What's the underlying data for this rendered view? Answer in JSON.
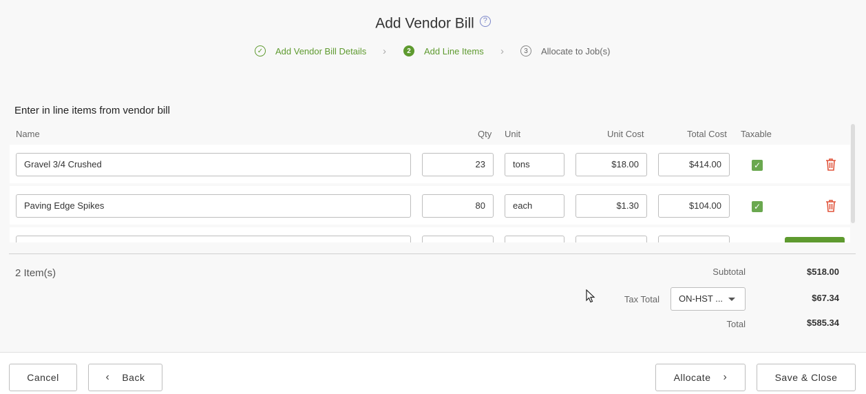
{
  "header": {
    "title": "Add Vendor Bill"
  },
  "steps": [
    {
      "num": "✓",
      "label": "Add Vendor Bill Details",
      "state": "done"
    },
    {
      "num": "2",
      "label": "Add Line Items",
      "state": "active"
    },
    {
      "num": "3",
      "label": "Allocate to Job(s)",
      "state": "todo"
    }
  ],
  "section_title": "Enter in line items from vendor bill",
  "columns": {
    "name": "Name",
    "qty": "Qty",
    "unit": "Unit",
    "unit_cost": "Unit Cost",
    "total_cost": "Total Cost",
    "taxable": "Taxable"
  },
  "line_items": [
    {
      "name": "Gravel 3/4 Crushed",
      "qty": "23",
      "unit": "tons",
      "unit_cost": "$18.00",
      "total_cost": "$414.00",
      "taxable": true
    },
    {
      "name": "Paving Edge Spikes",
      "qty": "80",
      "unit": "each",
      "unit_cost": "$1.30",
      "total_cost": "$104.00",
      "taxable": true
    }
  ],
  "summary": {
    "count": "2 Item(s)",
    "subtotal_label": "Subtotal",
    "subtotal": "$518.00",
    "tax_label": "Tax Total",
    "tax_select": "ON-HST ...",
    "tax": "$67.34",
    "total_label": "Total",
    "total": "$585.34"
  },
  "footer": {
    "cancel": "Cancel",
    "back": "Back",
    "allocate": "Allocate",
    "save_close": "Save & Close"
  },
  "colors": {
    "accent_green": "#5e9a2f",
    "danger": "#e0533a",
    "help": "#7b86c9"
  }
}
